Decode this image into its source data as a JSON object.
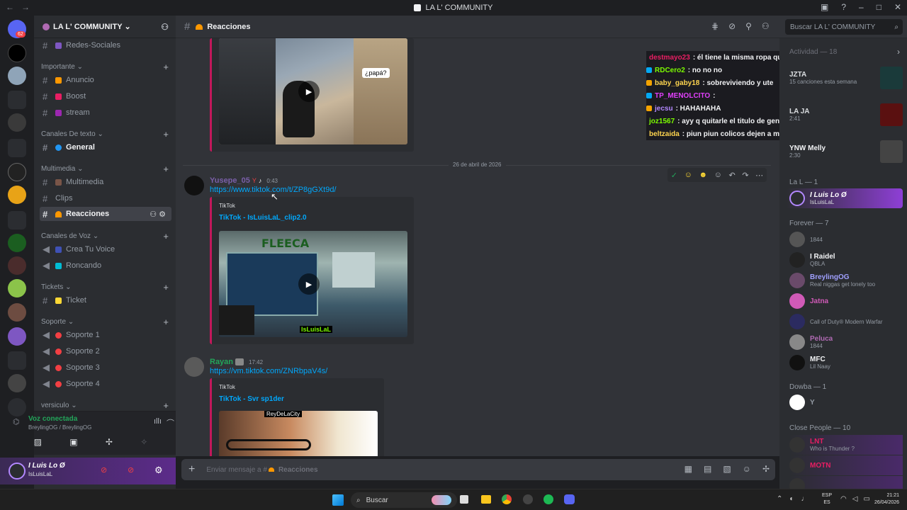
{
  "window": {
    "title": "LA L' COMMUNITY"
  },
  "guilds": {
    "badge": "62"
  },
  "server": {
    "name": "LA L' COMMUNITY"
  },
  "channels_top": [
    {
      "label": "Redes-Sociales"
    }
  ],
  "categories": {
    "importante": "Importante",
    "canales_texto": "Canales De texto",
    "multimedia": "Multimedia",
    "canales_voz": "Canales de Voz",
    "tickets": "Tickets",
    "soporte": "Soporte",
    "versiculo": "versiculo"
  },
  "channels": {
    "anuncio": "Anuncio",
    "boost": "Boost",
    "stream": "stream",
    "general": "General",
    "multimedia": "Multimedia",
    "clips": "Clips",
    "reacciones": "Reacciones",
    "crea_tu_voice": "Crea Tu Voice",
    "roncando": "Roncando",
    "ticket": "Ticket",
    "soporte1": "Soporte 1",
    "soporte2": "Soporte 2",
    "soporte3": "Soporte 3",
    "soporte4": "Soporte 4"
  },
  "voice": {
    "status": "Voz conectada",
    "detail": "BreylingOG / BreylingOG"
  },
  "user": {
    "name": "I Luis Lo Ø",
    "status": "IsLuisLaL"
  },
  "header": {
    "channel": "Reacciones",
    "search_placeholder": "Buscar LA L' COMMUNITY"
  },
  "chat": {
    "date_divider": "26 de abril de 2026",
    "msg1": {
      "author": "Yusepe_05",
      "time": "0:43",
      "link": "https://www.tiktok.com/t/ZP8gGXt9d/",
      "provider": "TikTok",
      "title": "TikTok - IsLuisLaL_clip2.0",
      "thumb_text": "FLEECA",
      "thumb_caption": "IsLuisLaL"
    },
    "msg2": {
      "author": "Rayan",
      "time": "17:42",
      "link": "https://vm.tiktok.com/ZNRbpaV4s/",
      "provider": "TikTok",
      "title": "TikTok - Svr sp1der",
      "thumb_caption": "ReyDeLaCity"
    },
    "top_thumb_caption": "¿papá?"
  },
  "composer": {
    "placeholder_prefix": "Enviar mensaje a #",
    "channel": "Reacciones"
  },
  "twitch_overlay": [
    {
      "name": "destmayo23",
      "text": ": él tiene la misma ropa que tú tenías el sábado en rol",
      "color": "#e91e63"
    },
    {
      "name": "RDCero2",
      "text": ": no no no",
      "color": "#7cfc00"
    },
    {
      "name": "baby_gaby18",
      "text": ": sobreviviendo y ute",
      "color": "#ffd54f"
    },
    {
      "name": "TP_MENOLCITO",
      "text": ":",
      "color": "#e040fb"
    },
    {
      "name": "jecsu",
      "text": ": HAHAHAHA",
      "color": "#b388ff"
    },
    {
      "name": "joz1567",
      "text": ": ayy q quitarle el titulo de general a luis",
      "color": "#7cfc00"
    },
    {
      "name": "beltzaida",
      "text": ": piun piun colicos dejen a mi pinchecha",
      "color": "#ffd54f"
    }
  ],
  "members": {
    "activity_label": "Actividad — 18",
    "activity": [
      {
        "name": "JZTA",
        "status": "15 canciones esta semana"
      },
      {
        "name": "LA JA",
        "status": "2:41"
      },
      {
        "name": "YNW Melly",
        "status": "2:30"
      }
    ],
    "lal_label": "La L — 1",
    "lal": [
      {
        "name": "I Luis Lo Ø",
        "status": "IsLuisLaL"
      }
    ],
    "forever_label": "Forever — 7",
    "forever": [
      {
        "name": "",
        "status": "1844",
        "color": "#949ba4"
      },
      {
        "name": "I Raidel",
        "status": "QBLA",
        "color": "#f2f3f5"
      },
      {
        "name": "BreylingOG",
        "status": "Real niggas get lonely too",
        "color": "#a0a0ff"
      },
      {
        "name": "Jatna",
        "status": "",
        "color": "#d05ab7"
      },
      {
        "name": "",
        "status": "Call of Duty® Modern Warfar",
        "color": "#949ba4"
      },
      {
        "name": "Peluca",
        "status": "1844",
        "color": "#b06ab3"
      },
      {
        "name": "MFC",
        "status": "Lil Naay",
        "color": "#f2f3f5"
      }
    ],
    "dowba_label": "Dowba — 1",
    "close_label": "Close People — 10",
    "close": [
      {
        "name": "LNT",
        "status": "Who is Thunder ?",
        "color": "#e91e63"
      },
      {
        "name": "MOTN",
        "status": "",
        "color": "#e91e63"
      },
      {
        "name": "",
        "status": "",
        "color": "#e91e63"
      }
    ]
  },
  "taskbar": {
    "search": "Buscar",
    "lang": "ESP",
    "region": "ES",
    "time": "21:21",
    "date": "26/04/2026"
  }
}
